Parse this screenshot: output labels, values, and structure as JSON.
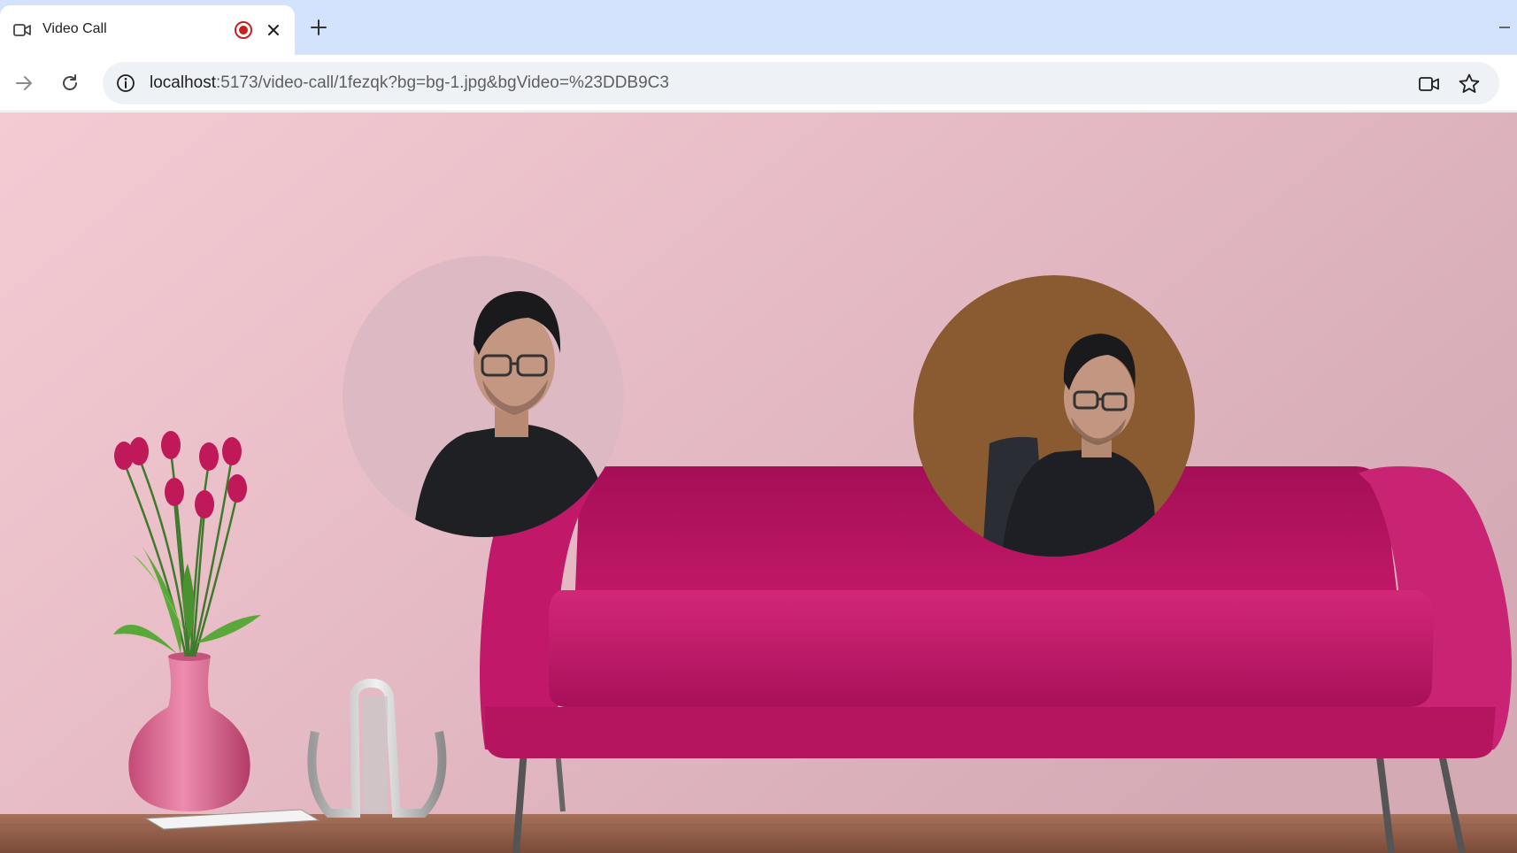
{
  "browser": {
    "tab": {
      "title": "Video Call",
      "icon": "video-camera-icon",
      "recording_indicator": "recording-icon",
      "close_icon": "close-icon"
    },
    "new_tab_icon": "plus-icon",
    "minimize_icon": "minimize-icon",
    "toolbar": {
      "forward_icon": "arrow-right-icon",
      "reload_icon": "reload-icon",
      "site_info_icon": "info-icon",
      "url_host": "localhost",
      "url_rest": ":5173/video-call/1fezqk?bg=bg-1.jpg&bgVideo=%23DDB9C3",
      "camera_icon": "video-camera-icon",
      "bookmark_icon": "star-icon"
    },
    "colors": {
      "tabstrip": "#d3e3fd",
      "recording": "#c5221f",
      "sofa": "#b3125f",
      "wall": "#e4bcc6",
      "participant2_bg": "#8a5a31"
    }
  },
  "call": {
    "participants": [
      {
        "id": "participant-1",
        "background": "#DDB9C3"
      },
      {
        "id": "participant-2",
        "background": "#8A5A31"
      }
    ]
  }
}
